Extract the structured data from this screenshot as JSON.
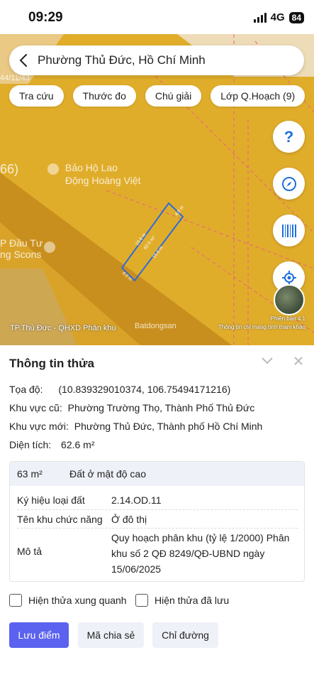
{
  "status": {
    "time": "09:29",
    "network": "4G",
    "battery": "84"
  },
  "search": {
    "text": "Phường Thủ Đức, Hồ Chí Minh"
  },
  "chips": [
    "Tra cứu",
    "Thước đo",
    "Chú giải",
    "Lớp Q.Hoạch (9)"
  ],
  "map": {
    "labels": [
      "44/11/43",
      "66)",
      "Bảo Hộ Lao",
      "Động Hoàng Việt",
      "P Đầu Tư",
      "ng Scons"
    ],
    "plot": {
      "top_edge": "4.0 m",
      "bottom_edge": "4.0 m",
      "left_edge": "15.6 m",
      "right_edge": "15.6 m",
      "area": "62.6 m²"
    },
    "zone_label": "TP.Thủ Đức - QHXD Phân khu",
    "watermark": "Batdongsan",
    "version": "Phiên bản 4.1",
    "disclaimer": "Thông tin chỉ mang tính tham khảo",
    "colors": {
      "land": "#e0ad2b",
      "road": "#c98f1e",
      "plot_outline": "#2f6bd4",
      "boundary": "#e8647a"
    }
  },
  "panel": {
    "title": "Thông tin thửa",
    "coord_label": "Tọa độ:",
    "coord_value": "(10.839329010374, 106.75494171216)",
    "old_area_label": "Khu vực cũ:",
    "old_area_value": "Phường Trường Thọ, Thành Phố Thủ Đức",
    "new_area_label": "Khu vực mới:",
    "new_area_value": "Phường Thủ Đức, Thành phố Hồ Chí Minh",
    "area_label": "Diện tích:",
    "area_value": "62.6 m²",
    "card": {
      "area": "63 m²",
      "land_use": "Đất ở mật độ cao",
      "rows": [
        {
          "key": "Ký hiệu loại đất",
          "value": "2.14.OD.11"
        },
        {
          "key": "Tên khu chức năng",
          "value": "Ở đô thị"
        },
        {
          "key": "Mô tả",
          "value": "Quy hoạch phân khu (tỷ lệ 1/2000) Phân khu số 2 QĐ 8249/QĐ-UBND ngày 15/06/2025"
        }
      ]
    },
    "checkboxes": [
      "Hiện thửa xung quanh",
      "Hiện thửa đã lưu"
    ],
    "buttons": {
      "save": "Lưu điểm",
      "share": "Mã chia sẻ",
      "directions": "Chỉ đường"
    }
  }
}
